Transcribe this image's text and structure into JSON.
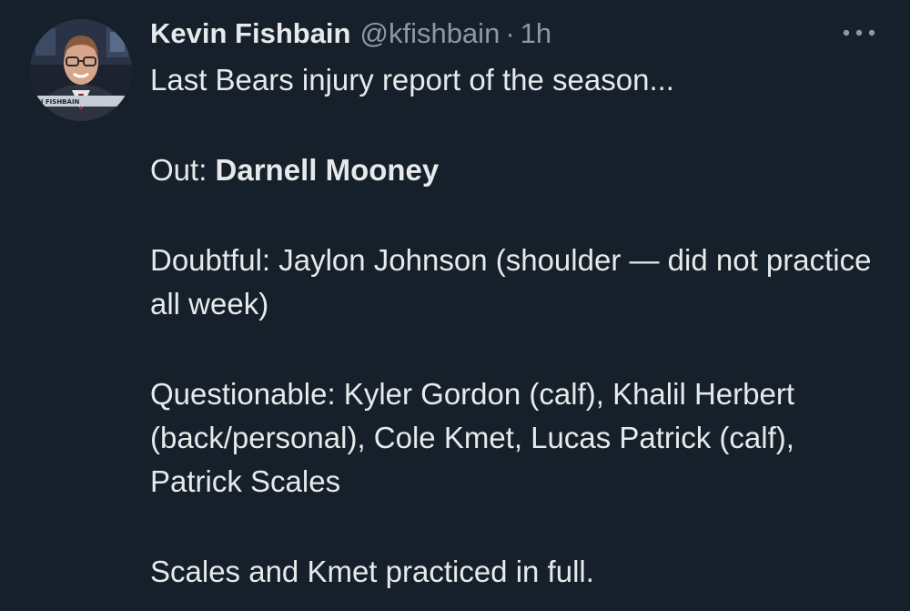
{
  "tweet": {
    "author": {
      "display_name": "Kevin Fishbain",
      "handle": "@kfishbain",
      "avatar_caption": "IN FISHBAIN"
    },
    "separator": "·",
    "timestamp": "1h",
    "more_icon": "more-horizontal-icon",
    "paragraphs": {
      "p1": "Last Bears injury report of the season...",
      "p2_label": "Out: ",
      "p2_name": "Darnell Mooney",
      "p3": "Doubtful: Jaylon Johnson (shoulder — did not practice all week)",
      "p4": "Questionable: Kyler Gordon (calf), Khalil Herbert (back/personal), Cole Kmet, Lucas Patrick (calf), Patrick Scales",
      "p5": "Scales and Kmet practiced in full."
    }
  },
  "colors": {
    "background": "#15202b",
    "primary_text": "#e7e9ea",
    "secondary_text": "#8b98a5"
  }
}
